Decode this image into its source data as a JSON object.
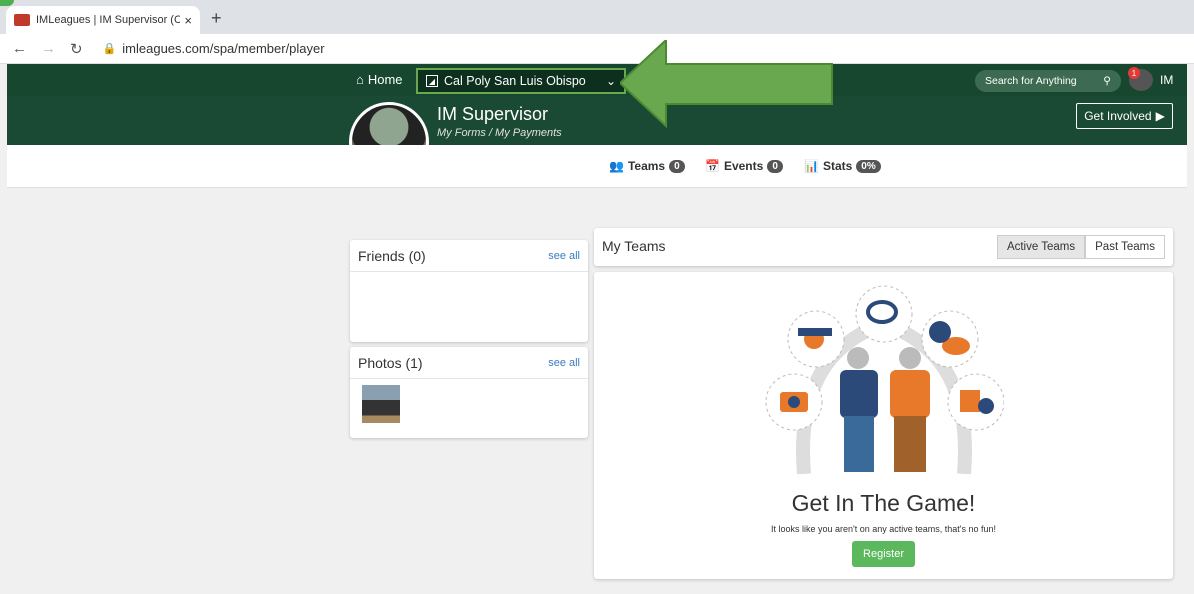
{
  "browser": {
    "tab_title": "IMLeagues | IM Supervisor (Cal P",
    "tab_close": "×",
    "new_tab": "+",
    "url": "imleagues.com/spa/member/player"
  },
  "nav": {
    "home": "Home",
    "school": "Cal Poly San Luis Obispo",
    "search_placeholder": "Search for Anything",
    "notification_count": "1",
    "user_initials": "IM"
  },
  "profile": {
    "name": "IM Supervisor",
    "links": "My Forms /   My Payments",
    "get_involved": "Get Involved"
  },
  "stats": [
    {
      "label": "Teams",
      "count": "0"
    },
    {
      "label": "Events",
      "count": "0"
    },
    {
      "label": "Stats",
      "count": "0%"
    }
  ],
  "friends": {
    "title": "Friends (0)",
    "see_all": "see all"
  },
  "photos": {
    "title": "Photos (1)",
    "see_all": "see all"
  },
  "my_teams": {
    "title": "My Teams",
    "tabs": [
      "Active Teams",
      "Past Teams"
    ],
    "headline": "Get In The Game!",
    "message": "It looks like you aren't on any active teams, that's no fun!",
    "register": "Register"
  },
  "colors": {
    "header_green": "#17472f",
    "register_green": "#5cb85c",
    "arrow_green": "#6aa84f"
  },
  "icons": [
    "home-icon",
    "school-icon",
    "chevron-down-icon",
    "search-icon",
    "teams-icon",
    "calendar-icon",
    "stats-icon",
    "play-icon"
  ]
}
